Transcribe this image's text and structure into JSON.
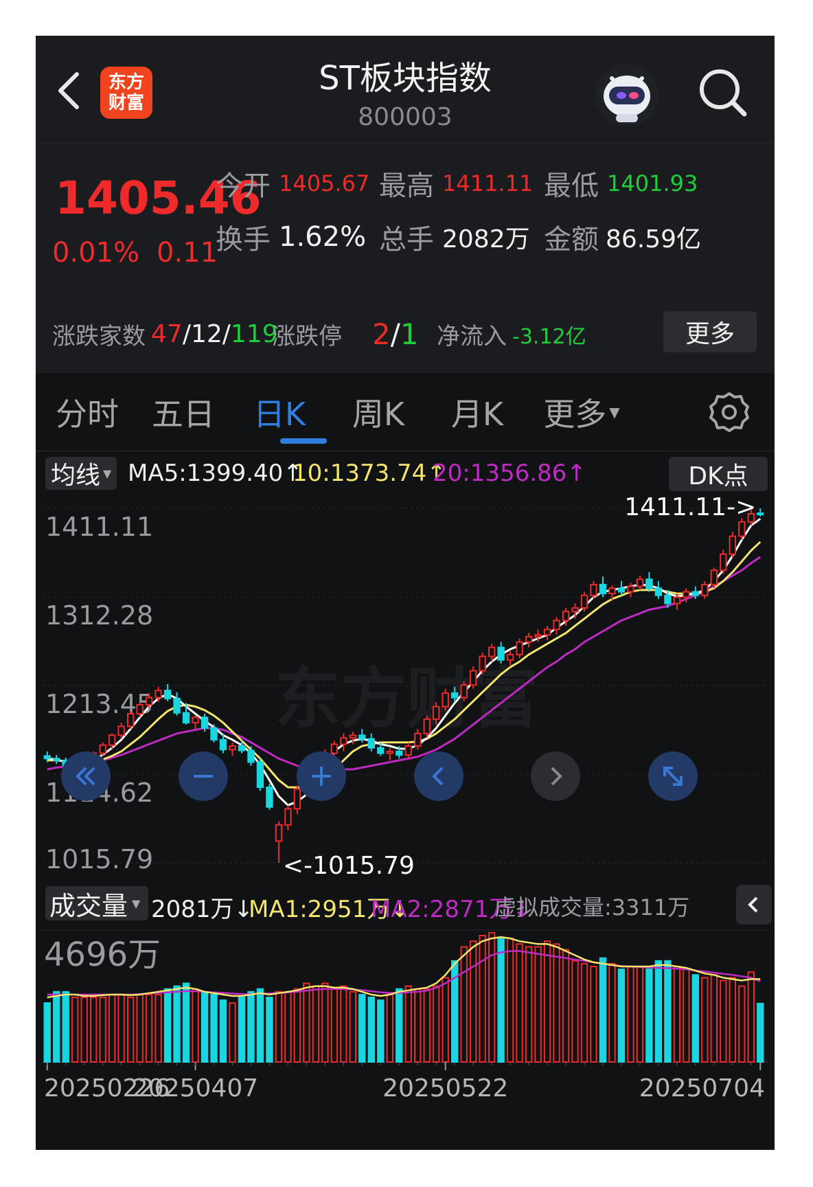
{
  "header": {
    "logo_text": "东方\n财富",
    "title": "ST板块指数",
    "code": "800003"
  },
  "quote": {
    "price": "1405.46",
    "change_pct": "0.01%",
    "change": "0.11",
    "open_label": "今开",
    "open": "1405.67",
    "high_label": "最高",
    "high": "1411.11",
    "low_label": "最低",
    "low": "1401.93",
    "turnover_label": "换手",
    "turnover": "1.62%",
    "volume_label": "总手",
    "volume": "2082万",
    "amount_label": "金额",
    "amount": "86.59亿",
    "breadth_label": "涨跌家数",
    "up_count": "47",
    "flat_count": "12",
    "down_count": "119",
    "limit_label": "涨跌停",
    "limit_up": "2",
    "limit_down": "1",
    "inflow_label": "净流入",
    "inflow": "-3.12亿",
    "more_label": "更多"
  },
  "tabs": [
    "分时",
    "五日",
    "日K",
    "周K",
    "月K",
    "更多"
  ],
  "active_tab": "日K",
  "ma_bar": {
    "select_label": "均线",
    "ma5": "MA5:1399.40↑",
    "ma10": "10:1373.74↑",
    "ma20": "20:1356.86↑",
    "dk_label": "DK点"
  },
  "volume_bar": {
    "select_label": "成交量",
    "vol": "2081万↓",
    "ma1": "MA1:2951万↓",
    "ma2": "MA2:2871万↓",
    "virtual": "虚拟成交量:3311万",
    "max_label": "4696万"
  },
  "price_axis": [
    "1411.11",
    "1312.28",
    "1213.45",
    "1114.62",
    "1015.79"
  ],
  "watermark": "东方财富",
  "colors": {
    "up": "#ee2a2a",
    "down": "#19d6e0",
    "accent": "#2f7fe0",
    "ma5": "#ffffff",
    "ma10": "#f5e56b",
    "ma20": "#c02ac4"
  },
  "chart_data": {
    "type": "candlestick",
    "ylim": [
      1015.79,
      1411.11
    ],
    "x_ticks": [
      "20250226",
      "20250407",
      "20250522",
      "20250704"
    ],
    "annotations": {
      "high": "1411.11->",
      "low": "<-1015.79"
    },
    "candles": [
      [
        1135,
        1140,
        1128,
        1132
      ],
      [
        1132,
        1136,
        1126,
        1130
      ],
      [
        1130,
        1133,
        1120,
        1124
      ],
      [
        1124,
        1130,
        1118,
        1128
      ],
      [
        1128,
        1135,
        1124,
        1133
      ],
      [
        1133,
        1140,
        1130,
        1138
      ],
      [
        1138,
        1150,
        1135,
        1147
      ],
      [
        1147,
        1160,
        1143,
        1158
      ],
      [
        1158,
        1172,
        1154,
        1168
      ],
      [
        1168,
        1185,
        1165,
        1182
      ],
      [
        1182,
        1195,
        1178,
        1192
      ],
      [
        1192,
        1205,
        1188,
        1200
      ],
      [
        1200,
        1212,
        1195,
        1208
      ],
      [
        1208,
        1215,
        1196,
        1199
      ],
      [
        1199,
        1206,
        1180,
        1183
      ],
      [
        1183,
        1194,
        1170,
        1172
      ],
      [
        1172,
        1180,
        1165,
        1178
      ],
      [
        1178,
        1182,
        1162,
        1166
      ],
      [
        1166,
        1170,
        1150,
        1153
      ],
      [
        1153,
        1160,
        1138,
        1142
      ],
      [
        1142,
        1150,
        1135,
        1146
      ],
      [
        1146,
        1152,
        1138,
        1141
      ],
      [
        1141,
        1146,
        1124,
        1128
      ],
      [
        1128,
        1132,
        1096,
        1100
      ],
      [
        1100,
        1104,
        1075,
        1078
      ],
      [
        1040,
        1062,
        1015.79,
        1058
      ],
      [
        1058,
        1080,
        1052,
        1076
      ],
      [
        1076,
        1102,
        1070,
        1098
      ],
      [
        1098,
        1122,
        1094,
        1118
      ],
      [
        1118,
        1134,
        1112,
        1130
      ],
      [
        1130,
        1142,
        1124,
        1138
      ],
      [
        1138,
        1152,
        1132,
        1148
      ],
      [
        1148,
        1160,
        1140,
        1155
      ],
      [
        1155,
        1162,
        1148,
        1158
      ],
      [
        1158,
        1165,
        1150,
        1154
      ],
      [
        1154,
        1160,
        1140,
        1144
      ],
      [
        1144,
        1150,
        1135,
        1138
      ],
      [
        1138,
        1144,
        1130,
        1140
      ],
      [
        1140,
        1146,
        1132,
        1136
      ],
      [
        1136,
        1150,
        1132,
        1146
      ],
      [
        1146,
        1165,
        1142,
        1160
      ],
      [
        1160,
        1180,
        1155,
        1176
      ],
      [
        1176,
        1195,
        1170,
        1190
      ],
      [
        1190,
        1210,
        1185,
        1205
      ],
      [
        1205,
        1212,
        1195,
        1200
      ],
      [
        1200,
        1218,
        1196,
        1214
      ],
      [
        1214,
        1235,
        1210,
        1230
      ],
      [
        1230,
        1250,
        1226,
        1246
      ],
      [
        1246,
        1260,
        1240,
        1256
      ],
      [
        1256,
        1262,
        1238,
        1242
      ],
      [
        1242,
        1252,
        1236,
        1248
      ],
      [
        1248,
        1266,
        1244,
        1262
      ],
      [
        1262,
        1272,
        1256,
        1268
      ],
      [
        1268,
        1276,
        1262,
        1270
      ],
      [
        1270,
        1280,
        1264,
        1276
      ],
      [
        1276,
        1290,
        1270,
        1286
      ],
      [
        1286,
        1300,
        1280,
        1296
      ],
      [
        1296,
        1305,
        1288,
        1300
      ],
      [
        1300,
        1318,
        1296,
        1314
      ],
      [
        1314,
        1330,
        1310,
        1326
      ],
      [
        1326,
        1335,
        1312,
        1316
      ],
      [
        1316,
        1325,
        1308,
        1322
      ],
      [
        1322,
        1330,
        1314,
        1318
      ],
      [
        1318,
        1328,
        1312,
        1324
      ],
      [
        1324,
        1336,
        1320,
        1332
      ],
      [
        1332,
        1340,
        1318,
        1322
      ],
      [
        1322,
        1330,
        1310,
        1314
      ],
      [
        1314,
        1320,
        1300,
        1305
      ],
      [
        1305,
        1316,
        1298,
        1312
      ],
      [
        1312,
        1322,
        1306,
        1318
      ],
      [
        1318,
        1324,
        1310,
        1314
      ],
      [
        1314,
        1330,
        1310,
        1326
      ],
      [
        1326,
        1345,
        1322,
        1342
      ],
      [
        1342,
        1365,
        1338,
        1360
      ],
      [
        1360,
        1385,
        1356,
        1380
      ],
      [
        1380,
        1400,
        1376,
        1396
      ],
      [
        1396,
        1410,
        1392,
        1405
      ],
      [
        1405.67,
        1411.11,
        1401.93,
        1405.46
      ]
    ],
    "ma5": [
      1132,
      1131,
      1128,
      1127,
      1129,
      1131,
      1136,
      1144,
      1153,
      1165,
      1178,
      1190,
      1199,
      1204,
      1199,
      1190,
      1182,
      1174,
      1167,
      1158,
      1153,
      1147,
      1138,
      1125,
      1108,
      1090,
      1080,
      1084,
      1092,
      1108,
      1126,
      1140,
      1148,
      1152,
      1154,
      1152,
      1148,
      1146,
      1143,
      1143,
      1147,
      1155,
      1166,
      1180,
      1194,
      1206,
      1218,
      1230,
      1240,
      1248,
      1254,
      1258,
      1262,
      1266,
      1270,
      1278,
      1285,
      1292,
      1302,
      1312,
      1318,
      1320,
      1322,
      1324,
      1326,
      1325,
      1322,
      1316,
      1313,
      1314,
      1316,
      1320,
      1330,
      1342,
      1358,
      1376,
      1392,
      1399.4
    ],
    "ma10": [
      1130,
      1130,
      1129,
      1128,
      1128,
      1129,
      1131,
      1135,
      1140,
      1148,
      1156,
      1166,
      1176,
      1185,
      1190,
      1192,
      1190,
      1186,
      1180,
      1172,
      1162,
      1152,
      1142,
      1132,
      1120,
      1108,
      1100,
      1100,
      1100,
      1104,
      1110,
      1120,
      1130,
      1140,
      1146,
      1148,
      1150,
      1150,
      1150,
      1150,
      1151,
      1154,
      1160,
      1168,
      1176,
      1186,
      1196,
      1206,
      1216,
      1226,
      1234,
      1240,
      1248,
      1254,
      1260,
      1266,
      1272,
      1280,
      1288,
      1296,
      1304,
      1310,
      1314,
      1318,
      1320,
      1320,
      1320,
      1318,
      1316,
      1316,
      1316,
      1318,
      1322,
      1330,
      1340,
      1352,
      1364,
      1373.74
    ],
    "ma20": [
      1120,
      1122,
      1123,
      1124,
      1126,
      1128,
      1130,
      1133,
      1136,
      1140,
      1144,
      1148,
      1152,
      1156,
      1160,
      1162,
      1164,
      1166,
      1166,
      1164,
      1160,
      1156,
      1150,
      1144,
      1138,
      1132,
      1128,
      1124,
      1122,
      1120,
      1120,
      1120,
      1120,
      1120,
      1122,
      1124,
      1126,
      1128,
      1130,
      1132,
      1134,
      1138,
      1142,
      1148,
      1154,
      1162,
      1170,
      1178,
      1186,
      1194,
      1202,
      1210,
      1218,
      1226,
      1234,
      1240,
      1248,
      1254,
      1262,
      1268,
      1274,
      1280,
      1286,
      1290,
      1294,
      1298,
      1300,
      1302,
      1306,
      1310,
      1314,
      1318,
      1324,
      1330,
      1336,
      1342,
      1350,
      1356.86
    ],
    "volume_ylim": [
      0,
      4696
    ],
    "volumes": [
      2100,
      2500,
      2500,
      2300,
      2300,
      2300,
      2300,
      2400,
      2400,
      2300,
      2400,
      2400,
      2400,
      2600,
      2700,
      2800,
      2600,
      2500,
      2400,
      2200,
      2100,
      2300,
      2500,
      2600,
      2300,
      2500,
      2500,
      2600,
      2800,
      2700,
      2800,
      2600,
      2700,
      2500,
      2400,
      2300,
      2200,
      2400,
      2600,
      2700,
      2600,
      2600,
      2700,
      3000,
      3600,
      4100,
      4300,
      4500,
      4600,
      4400,
      4400,
      4200,
      4100,
      4100,
      4300,
      4200,
      4000,
      3600,
      3500,
      3400,
      3700,
      3500,
      3300,
      3400,
      3400,
      3300,
      3600,
      3600,
      3400,
      3300,
      3100,
      3000,
      3100,
      2900,
      3000,
      2700,
      3200,
      2081
    ],
    "vol_ma1": [
      2300,
      2350,
      2400,
      2400,
      2350,
      2350,
      2380,
      2400,
      2400,
      2380,
      2400,
      2450,
      2500,
      2550,
      2600,
      2650,
      2600,
      2500,
      2450,
      2400,
      2350,
      2350,
      2400,
      2450,
      2400,
      2450,
      2500,
      2550,
      2650,
      2700,
      2700,
      2650,
      2650,
      2600,
      2500,
      2400,
      2350,
      2400,
      2500,
      2550,
      2600,
      2650,
      2800,
      3100,
      3500,
      3800,
      4100,
      4300,
      4400,
      4450,
      4400,
      4300,
      4250,
      4200,
      4200,
      4100,
      3950,
      3800,
      3650,
      3550,
      3500,
      3450,
      3400,
      3400,
      3400,
      3400,
      3450,
      3450,
      3400,
      3350,
      3250,
      3150,
      3100,
      3000,
      2950,
      2900,
      2950,
      2951
    ],
    "vol_ma2": [
      2400,
      2400,
      2400,
      2400,
      2400,
      2400,
      2400,
      2400,
      2400,
      2400,
      2420,
      2440,
      2460,
      2480,
      2500,
      2520,
      2520,
      2500,
      2480,
      2460,
      2440,
      2420,
      2420,
      2440,
      2440,
      2460,
      2480,
      2500,
      2540,
      2580,
      2600,
      2600,
      2600,
      2580,
      2560,
      2520,
      2480,
      2460,
      2460,
      2480,
      2500,
      2540,
      2640,
      2800,
      3000,
      3200,
      3400,
      3600,
      3800,
      3900,
      3950,
      3950,
      3900,
      3850,
      3800,
      3750,
      3700,
      3650,
      3600,
      3550,
      3500,
      3450,
      3420,
      3400,
      3380,
      3360,
      3350,
      3340,
      3320,
      3300,
      3260,
      3220,
      3180,
      3140,
      3100,
      3050,
      3000,
      2871
    ]
  }
}
